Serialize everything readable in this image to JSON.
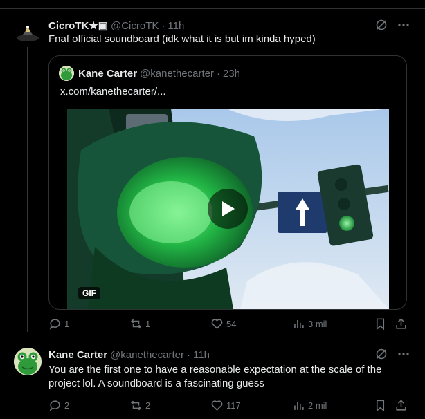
{
  "post1": {
    "display_name": "CicroTK★▣",
    "handle": "@CicroTK",
    "separator": "·",
    "time": "11h",
    "text": "Fnaf official soundboard (idk what it is but im kinda hyped)",
    "quote": {
      "display_name": "Kane Carter",
      "handle": "@kanethecarter",
      "separator": "·",
      "time": "23h",
      "link": "x.com/kanethecarter/...",
      "gif_label": "GIF"
    },
    "stats": {
      "replies": "1",
      "reposts": "1",
      "likes": "54",
      "views": "3 mil"
    }
  },
  "post2": {
    "display_name": "Kane Carter",
    "handle": "@kanethecarter",
    "separator": "·",
    "time": "11h",
    "text_line1": "You are the first one to have a reasonable expectation at the scale of the",
    "text_line2": "project lol. A soundboard is a fascinating guess",
    "stats": {
      "replies": "2",
      "reposts": "2",
      "likes": "117",
      "views": "2 mil"
    }
  },
  "colors": {
    "accent_green": "#1e9e3e",
    "muted": "#71767b",
    "border": "#2f3336",
    "text": "#e7e9ea"
  },
  "icons": [
    "grok-icon",
    "more-icon",
    "reply-icon",
    "repost-icon",
    "like-icon",
    "views-icon",
    "bookmark-icon",
    "share-icon",
    "play-icon"
  ]
}
